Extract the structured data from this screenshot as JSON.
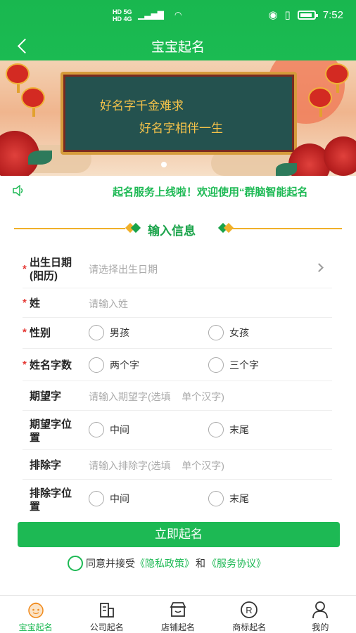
{
  "status": {
    "network": "HD 5G",
    "network2": "HD 4G",
    "time": "7:52"
  },
  "header": {
    "title": "宝宝起名"
  },
  "banner": {
    "line1": "好名字千金难求",
    "line2": "好名字相伴一生"
  },
  "notice": {
    "text": "起名服务上线啦！欢迎使用“群脑智能起名"
  },
  "section": {
    "title": "输入信息"
  },
  "form": {
    "birth_label": "出生日期\n(阳历)",
    "birth_placeholder": "请选择出生日期",
    "surname_label": "姓",
    "surname_placeholder": "请输入姓",
    "gender_label": "性别",
    "gender_options": [
      "男孩",
      "女孩"
    ],
    "length_label": "姓名字数",
    "length_options": [
      "两个字",
      "三个字"
    ],
    "want_label": "期望字",
    "want_placeholder": "请输入期望字(选填    单个汉字)",
    "want_pos_label": "期望字位置",
    "want_pos_options": [
      "中间",
      "末尾"
    ],
    "exclude_label": "排除字",
    "exclude_placeholder": "请输入排除字(选填    单个汉字)",
    "exclude_pos_label": "排除字位置",
    "exclude_pos_options": [
      "中间",
      "末尾"
    ]
  },
  "submit_label": "立即起名",
  "agreement": {
    "prefix": "同意并接受",
    "privacy": "《隐私政策》",
    "and": "和",
    "service": "《服务协议》"
  },
  "tabs": [
    {
      "label": "宝宝起名",
      "icon": "baby-icon",
      "active": true
    },
    {
      "label": "公司起名",
      "icon": "building-icon",
      "active": false
    },
    {
      "label": "店铺起名",
      "icon": "store-icon",
      "active": false
    },
    {
      "label": "商标起名",
      "icon": "registered-icon",
      "active": false
    },
    {
      "label": "我的",
      "icon": "user-icon",
      "active": false
    }
  ],
  "colors": {
    "brand": "#1db954",
    "required": "#e53935",
    "accent": "#f0b02a"
  }
}
